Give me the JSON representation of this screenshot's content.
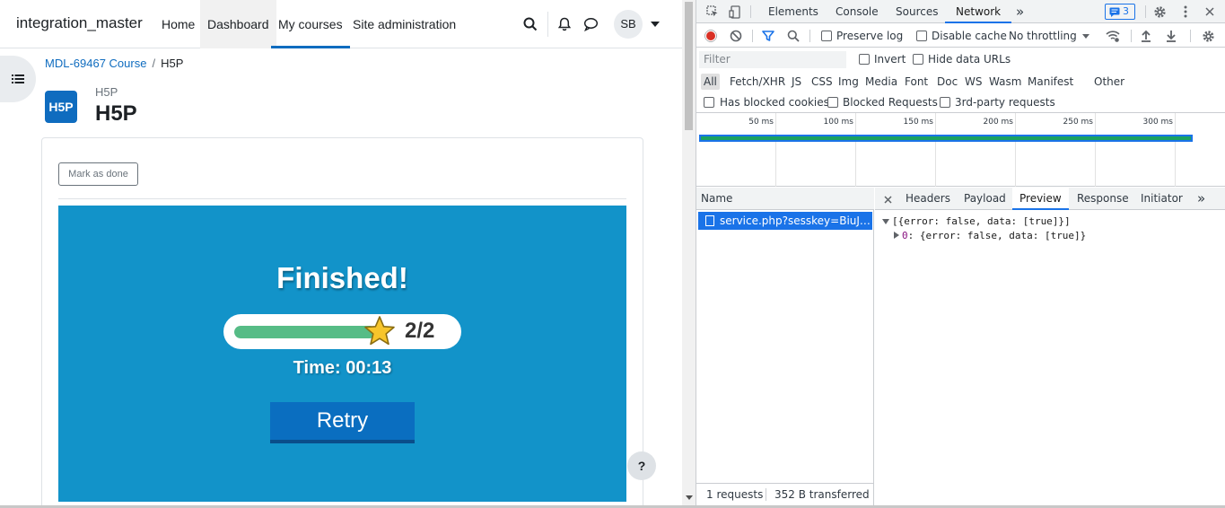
{
  "moodle": {
    "brand": "integration_master",
    "nav": {
      "home": "Home",
      "dashboard": "Dashboard",
      "my_courses": "My courses",
      "site_admin": "Site administration"
    },
    "user_initials": "SB",
    "breadcrumb": {
      "course": "MDL-69467 Course",
      "separator": "/",
      "current": "H5P"
    },
    "activity": {
      "logo_text": "H5P",
      "type_label": "H5P",
      "title": "H5P"
    },
    "mark_done_label": "Mark as done",
    "h5p": {
      "finished_text": "Finished!",
      "score_text": "2/2",
      "score_fraction": 1.0,
      "time_text": "Time: 00:13",
      "retry_label": "Retry"
    },
    "help_label": "?"
  },
  "devtools": {
    "tabs": [
      "Elements",
      "Console",
      "Sources",
      "Network"
    ],
    "more_tabs": "»",
    "issues_count": "3",
    "toolbar": {
      "preserve_log": "Preserve log",
      "disable_cache": "Disable cache",
      "throttling": "No throttling"
    },
    "filter": {
      "placeholder": "Filter",
      "invert": "Invert",
      "hide_data_urls": "Hide data URLs"
    },
    "types": [
      "All",
      "Fetch/XHR",
      "JS",
      "CSS",
      "Img",
      "Media",
      "Font",
      "Doc",
      "WS",
      "Wasm",
      "Manifest",
      "Other"
    ],
    "blocked": {
      "has_blocked_cookies": "Has blocked cookies",
      "blocked_requests": "Blocked Requests",
      "third_party": "3rd-party requests"
    },
    "overview_ticks": [
      "50 ms",
      "100 ms",
      "150 ms",
      "200 ms",
      "250 ms",
      "300 ms"
    ],
    "request_list": {
      "header": "Name",
      "request": "service.php?sesskey=BiuJHn..."
    },
    "status": {
      "requests": "1 requests",
      "transferred": "352 B transferred"
    },
    "detail_tabs": [
      "Headers",
      "Payload",
      "Preview",
      "Response",
      "Initiator"
    ],
    "detail_more": "»",
    "preview": {
      "line1": "[{error: false, data: [true]}]",
      "line2_key": "0",
      "line2_value": ": {error: false, data: [true]}"
    }
  }
}
